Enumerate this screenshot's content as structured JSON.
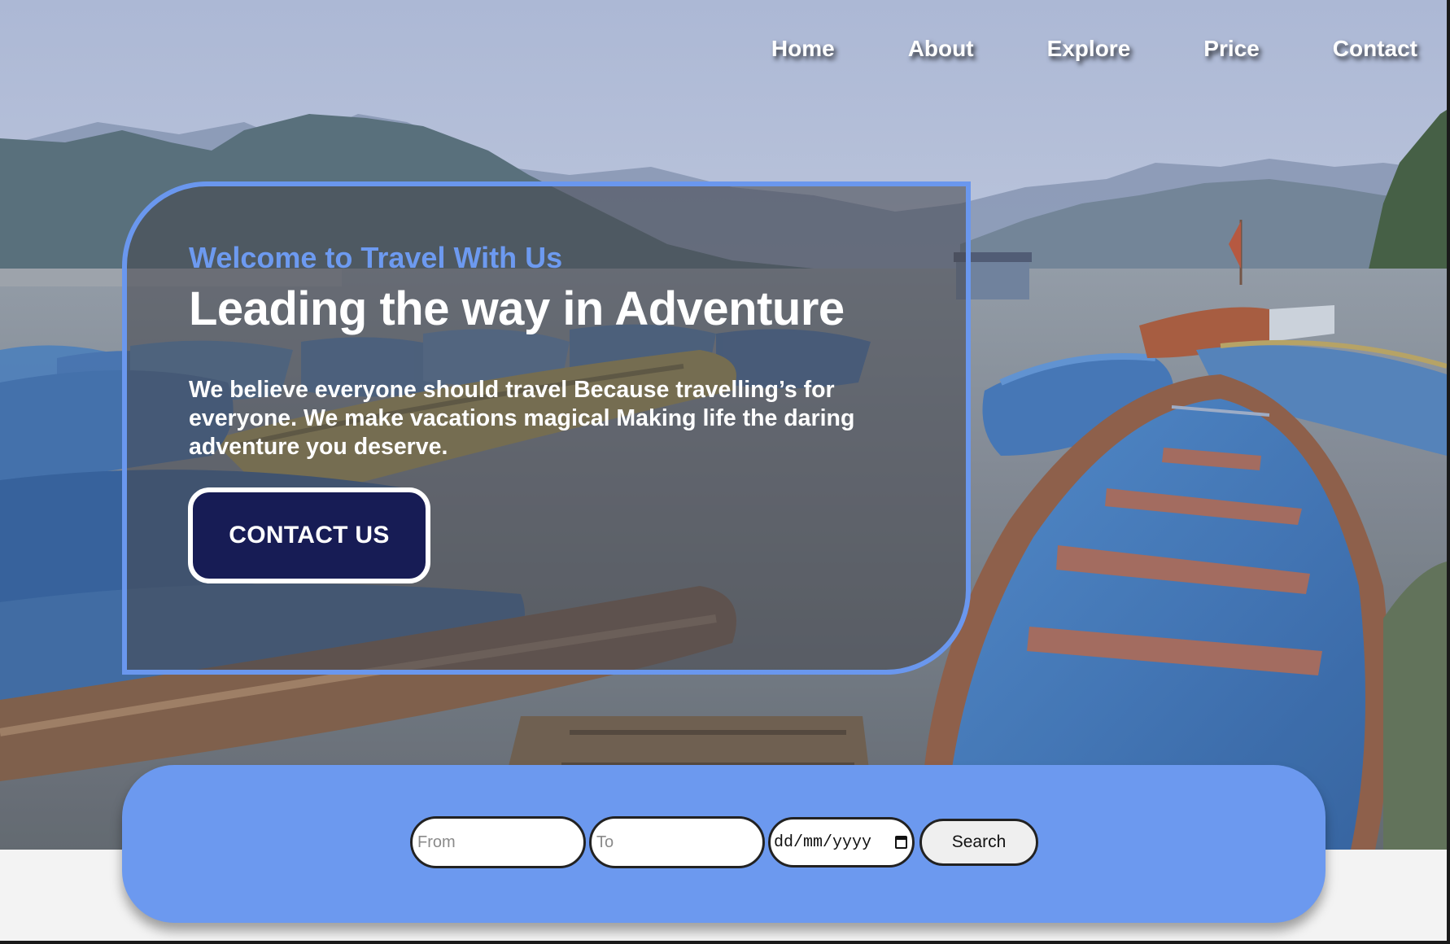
{
  "nav": {
    "items": [
      {
        "label": "Home"
      },
      {
        "label": "About"
      },
      {
        "label": "Explore"
      },
      {
        "label": "Price"
      },
      {
        "label": "Contact"
      }
    ]
  },
  "hero": {
    "eyebrow": "Welcome to Travel With Us",
    "title": "Leading the way in Adventure",
    "description": "We believe everyone should travel Because travelling’s for everyone. We make vacations magical Making life the daring adventure you deserve.",
    "cta_label": "CONTACT US",
    "background_image": "lake-with-blue-rowboats-and-mountains"
  },
  "search": {
    "from_placeholder": "From",
    "to_placeholder": "To",
    "date_placeholder": "dd/mm/yyyy",
    "button_label": "Search",
    "date_icon": "calendar-icon"
  },
  "colors": {
    "accent": "#6c99ef",
    "cta_background": "#171c55",
    "eyebrow": "#6d9af0",
    "page_background": "#f3f3f3"
  }
}
